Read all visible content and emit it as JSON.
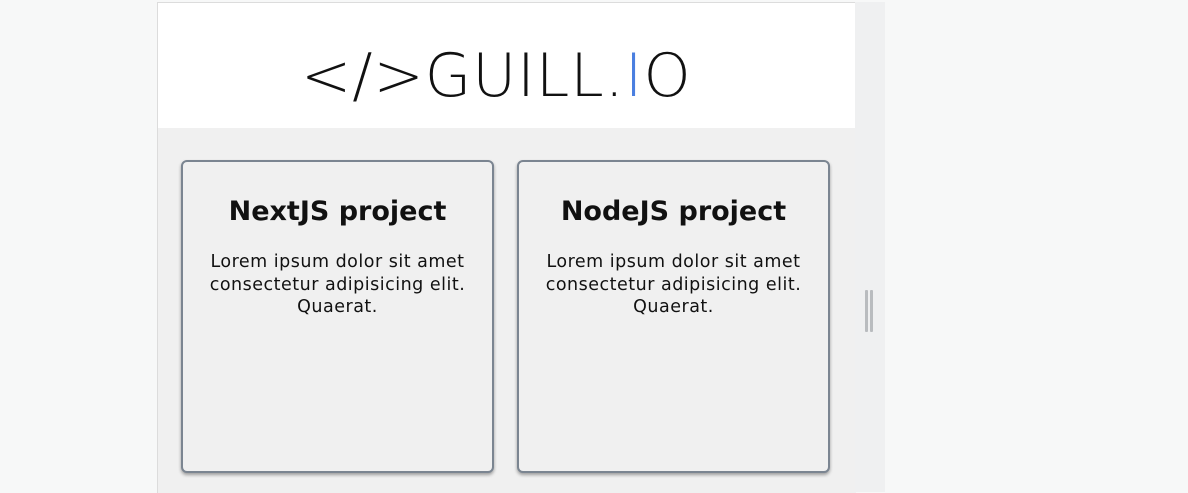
{
  "logo": {
    "prefix": "</>GUILL.",
    "accent": "I",
    "suffix": "O",
    "accent_color": "#4a7fe0"
  },
  "projects": [
    {
      "title": "NextJS project",
      "description": "Lorem ipsum dolor sit amet consectetur adipisicing elit. Quaerat."
    },
    {
      "title": "NodeJS project",
      "description": "Lorem ipsum dolor sit amet consectetur adipisicing elit. Quaerat."
    }
  ],
  "colors": {
    "page_background": "#f7f8f8",
    "content_background": "#f0f0f0",
    "header_background": "#ffffff",
    "card_border": "#7b8591",
    "text": "#111111"
  },
  "icons": {
    "resize_handle": "resize-grip-icon"
  }
}
